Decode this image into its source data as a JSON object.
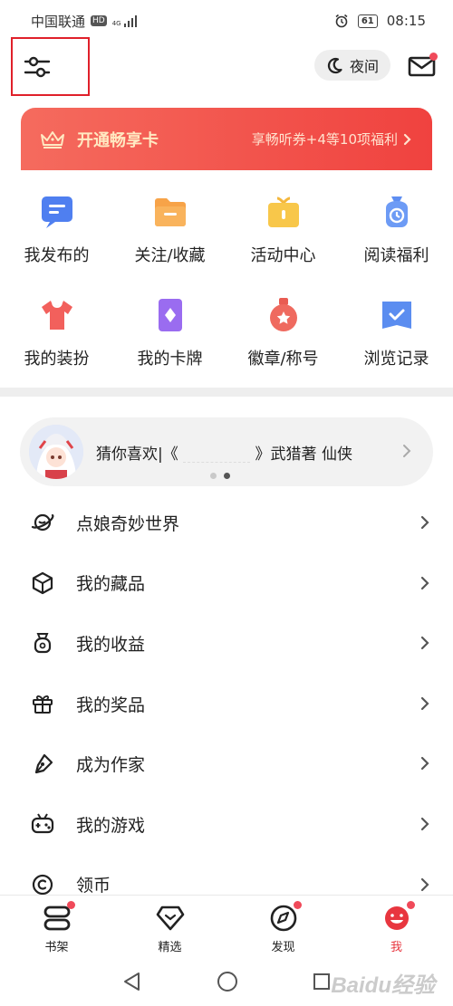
{
  "status_bar": {
    "carrier": "中国联通",
    "hd": "HD",
    "net": "4G",
    "battery": "61",
    "time": "08:15"
  },
  "header": {
    "night_label": "夜间",
    "mail_has_dot": true
  },
  "vip": {
    "title": "开通畅享卡",
    "promo": "享畅听券+4等10项福利"
  },
  "grid": [
    {
      "label": "我发布的",
      "icon": "message-icon"
    },
    {
      "label": "关注/收藏",
      "icon": "folder-icon"
    },
    {
      "label": "活动中心",
      "icon": "gift-box-icon"
    },
    {
      "label": "阅读福利",
      "icon": "clock-bag-icon"
    },
    {
      "label": "我的装扮",
      "icon": "tshirt-icon"
    },
    {
      "label": "我的卡牌",
      "icon": "card-icon"
    },
    {
      "label": "徽章/称号",
      "icon": "medal-icon"
    },
    {
      "label": "浏览记录",
      "icon": "history-book-icon"
    }
  ],
  "recommendation": {
    "prefix": "猜你喜欢|《",
    "suffix": "》武猎著 仙侠"
  },
  "menu": [
    {
      "label": "点娘奇妙世界",
      "icon": "planet-icon"
    },
    {
      "label": "我的藏品",
      "icon": "cube-icon"
    },
    {
      "label": "我的收益",
      "icon": "money-bag-icon"
    },
    {
      "label": "我的奖品",
      "icon": "gift-icon"
    },
    {
      "label": "成为作家",
      "icon": "pen-icon"
    },
    {
      "label": "我的游戏",
      "icon": "gamepad-icon"
    },
    {
      "label": "领币",
      "icon": "coin-icon"
    }
  ],
  "bottom_nav": [
    {
      "label": "书架",
      "icon": "bookshelf-icon",
      "dot": true
    },
    {
      "label": "精选",
      "icon": "diamond-icon",
      "dot": false
    },
    {
      "label": "发现",
      "icon": "compass-icon",
      "dot": true
    },
    {
      "label": "我",
      "icon": "me-icon",
      "dot": true,
      "active": true
    }
  ],
  "watermark": "Baidu经验",
  "colors": {
    "accent": "#e8363f",
    "vip_start": "#f56b5e",
    "vip_end": "#f0423f",
    "highlight_box": "#e0202a"
  }
}
